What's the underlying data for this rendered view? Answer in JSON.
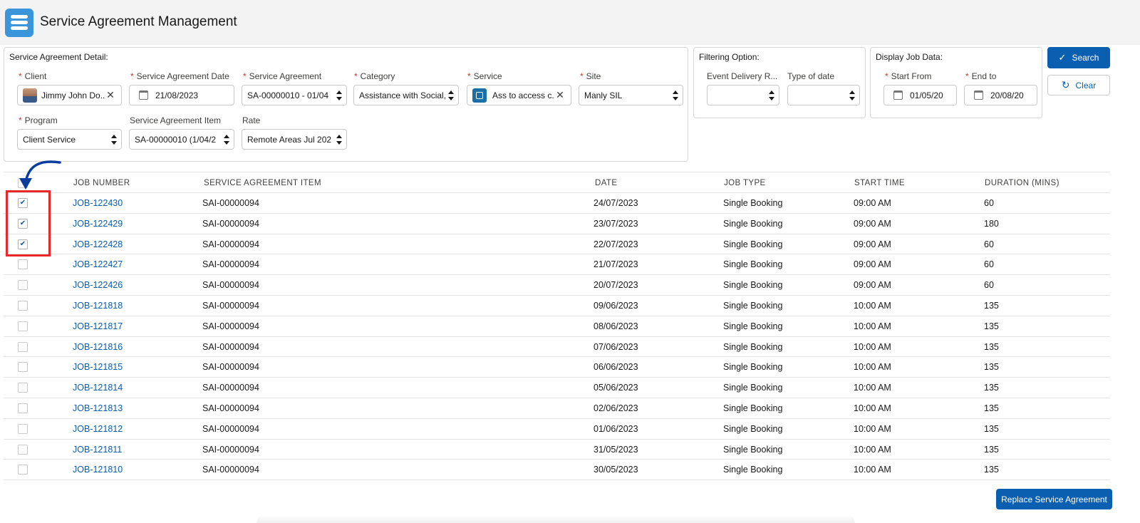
{
  "header": {
    "title": "Service Agreement Management",
    "icon": "stacked-lines-icon"
  },
  "detail_panel": {
    "title": "Service Agreement Detail:",
    "client": {
      "label": "Client",
      "value": "Jimmy John Do...",
      "required": true
    },
    "sa_date": {
      "label": "Service Agreement Date",
      "value": "21/08/2023",
      "required": true
    },
    "service_agreement": {
      "label": "Service Agreement",
      "value": "SA-00000010 - 01/04",
      "required": true
    },
    "category": {
      "label": "Category",
      "value": "Assistance with Social,",
      "required": true
    },
    "service": {
      "label": "Service",
      "value": "Ass to access c...",
      "required": true
    },
    "site": {
      "label": "Site",
      "value": "Manly SIL",
      "required": true
    },
    "program": {
      "label": "Program",
      "value": "Client Service",
      "required": true
    },
    "sa_item": {
      "label": "Service Agreement Item",
      "value": "SA-00000010 (1/04/2"
    },
    "rate": {
      "label": "Rate",
      "value": "Remote Areas Jul 202"
    }
  },
  "filter_panel": {
    "title": "Filtering Option:",
    "event_delivery": {
      "label": "Event Delivery R...",
      "value": ""
    },
    "type_of_date": {
      "label": "Type of date",
      "value": ""
    }
  },
  "display_panel": {
    "title": "Display Job Data:",
    "start_from": {
      "label": "Start From",
      "value": "01/05/20",
      "required": true
    },
    "end_to": {
      "label": "End to",
      "value": "20/08/20",
      "required": true
    }
  },
  "buttons": {
    "search": "Search",
    "clear": "Clear",
    "replace": "Replace Service Agreement"
  },
  "table": {
    "headers": {
      "job_number": "JOB NUMBER",
      "sa_item": "SERVICE AGREEMENT ITEM",
      "date": "DATE",
      "job_type": "JOB TYPE",
      "start_time": "START TIME",
      "duration": "DURATION (MINS)"
    },
    "rows": [
      {
        "checked": true,
        "job": "JOB-122430",
        "item": "SAI-00000094",
        "date": "24/07/2023",
        "type": "Single Booking",
        "time": "09:00 AM",
        "duration": "60"
      },
      {
        "checked": true,
        "job": "JOB-122429",
        "item": "SAI-00000094",
        "date": "23/07/2023",
        "type": "Single Booking",
        "time": "09:00 AM",
        "duration": "180"
      },
      {
        "checked": true,
        "job": "JOB-122428",
        "item": "SAI-00000094",
        "date": "22/07/2023",
        "type": "Single Booking",
        "time": "09:00 AM",
        "duration": "60"
      },
      {
        "checked": false,
        "job": "JOB-122427",
        "item": "SAI-00000094",
        "date": "21/07/2023",
        "type": "Single Booking",
        "time": "09:00 AM",
        "duration": "60"
      },
      {
        "checked": false,
        "job": "JOB-122426",
        "item": "SAI-00000094",
        "date": "20/07/2023",
        "type": "Single Booking",
        "time": "09:00 AM",
        "duration": "60"
      },
      {
        "checked": false,
        "job": "JOB-121818",
        "item": "SAI-00000094",
        "date": "09/06/2023",
        "type": "Single Booking",
        "time": "10:00 AM",
        "duration": "135"
      },
      {
        "checked": false,
        "job": "JOB-121817",
        "item": "SAI-00000094",
        "date": "08/06/2023",
        "type": "Single Booking",
        "time": "10:00 AM",
        "duration": "135"
      },
      {
        "checked": false,
        "job": "JOB-121816",
        "item": "SAI-00000094",
        "date": "07/06/2023",
        "type": "Single Booking",
        "time": "10:00 AM",
        "duration": "135"
      },
      {
        "checked": false,
        "job": "JOB-121815",
        "item": "SAI-00000094",
        "date": "06/06/2023",
        "type": "Single Booking",
        "time": "10:00 AM",
        "duration": "135"
      },
      {
        "checked": false,
        "job": "JOB-121814",
        "item": "SAI-00000094",
        "date": "05/06/2023",
        "type": "Single Booking",
        "time": "10:00 AM",
        "duration": "135"
      },
      {
        "checked": false,
        "job": "JOB-121813",
        "item": "SAI-00000094",
        "date": "02/06/2023",
        "type": "Single Booking",
        "time": "10:00 AM",
        "duration": "135"
      },
      {
        "checked": false,
        "job": "JOB-121812",
        "item": "SAI-00000094",
        "date": "01/06/2023",
        "type": "Single Booking",
        "time": "10:00 AM",
        "duration": "135"
      },
      {
        "checked": false,
        "job": "JOB-121811",
        "item": "SAI-00000094",
        "date": "31/05/2023",
        "type": "Single Booking",
        "time": "10:00 AM",
        "duration": "135"
      },
      {
        "checked": false,
        "job": "JOB-121810",
        "item": "SAI-00000094",
        "date": "30/05/2023",
        "type": "Single Booking",
        "time": "10:00 AM",
        "duration": "135"
      }
    ]
  },
  "colors": {
    "brand": "#0b5fb0",
    "link": "#0b5cab",
    "highlight": "#e8282a",
    "required": "#c23934"
  }
}
